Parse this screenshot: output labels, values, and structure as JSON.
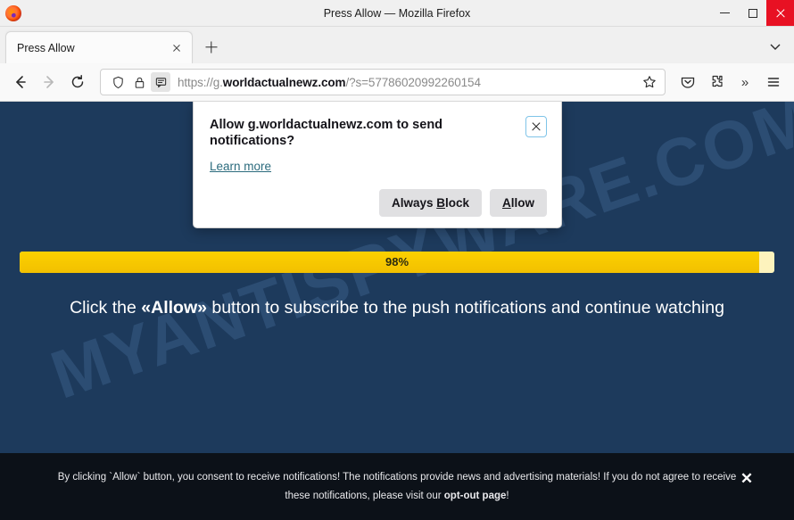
{
  "window": {
    "title": "Press Allow — Mozilla Firefox",
    "logo_icon": "firefox-logo",
    "minimize_label": "—",
    "maximize_label": "□",
    "close_label": "✕"
  },
  "tabs": {
    "items": [
      {
        "label": "Press Allow",
        "close_icon": "close-icon"
      }
    ],
    "new_tab_icon": "plus-icon",
    "list_all_tabs_icon": "chevron-down-icon"
  },
  "toolbar": {
    "back_icon": "arrow-left-icon",
    "forward_icon": "arrow-right-icon",
    "reload_icon": "reload-icon",
    "shield_icon": "shield-icon",
    "lock_icon": "lock-icon",
    "permission_icon": "notification-bubble-icon",
    "bookmark_icon": "star-icon",
    "pocket_icon": "pocket-icon",
    "extensions_icon": "puzzle-piece-icon",
    "overflow_icon": "double-chevron-right-icon",
    "menu_icon": "hamburger-menu-icon",
    "url": {
      "scheme": "https://",
      "host_prefix": "g.",
      "host_bold": "worldactualnewz.com",
      "path": "/?s=57786020992260154"
    }
  },
  "permission_popup": {
    "title": "Allow g.worldactualnewz.com to send notifications?",
    "learn_more": "Learn more",
    "close_icon": "close-icon",
    "buttons": {
      "block_prefix": "Always ",
      "block_accel": "B",
      "block_suffix": "lock",
      "allow_accel": "A",
      "allow_suffix": "llow"
    }
  },
  "page": {
    "watermark": "MYANTISPYWARE.COM",
    "progress": {
      "percent_label": "98%",
      "percent_value": 98
    },
    "cta_prefix": "Click the ",
    "cta_bold": "«Allow»",
    "cta_suffix": " button to subscribe to the push notifications and continue watching"
  },
  "consent_bar": {
    "text_part1": "By clicking `Allow` button, you consent to receive notifications! The notifications provide news and advertising materials! If you do not agree to receive these notifications, please visit our ",
    "link_text": "opt-out page",
    "text_part2": "!",
    "close_icon": "close-icon",
    "close_label": "✕"
  },
  "colors": {
    "page_background": "#1d3a5c",
    "progress_fill": "#f2c000",
    "progress_track": "#fdf3bd",
    "consent_background": "#0c1118",
    "close_button": "#e81123"
  }
}
